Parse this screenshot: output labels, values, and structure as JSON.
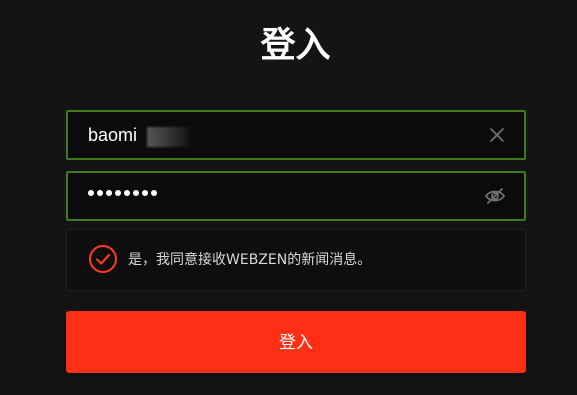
{
  "page": {
    "title": "登入",
    "accent_color": "#ff2f16",
    "field_border_color": "#3f7a1f"
  },
  "form": {
    "username": {
      "value": "baomi",
      "clear_icon": "close-icon"
    },
    "password": {
      "masked_value": "••••••••",
      "toggle_icon": "eye-off-icon"
    },
    "consent": {
      "checked": true,
      "label": "是，我同意接收WEBZEN的新闻消息。",
      "icon": "check-circle-icon"
    },
    "submit_label": "登入"
  }
}
